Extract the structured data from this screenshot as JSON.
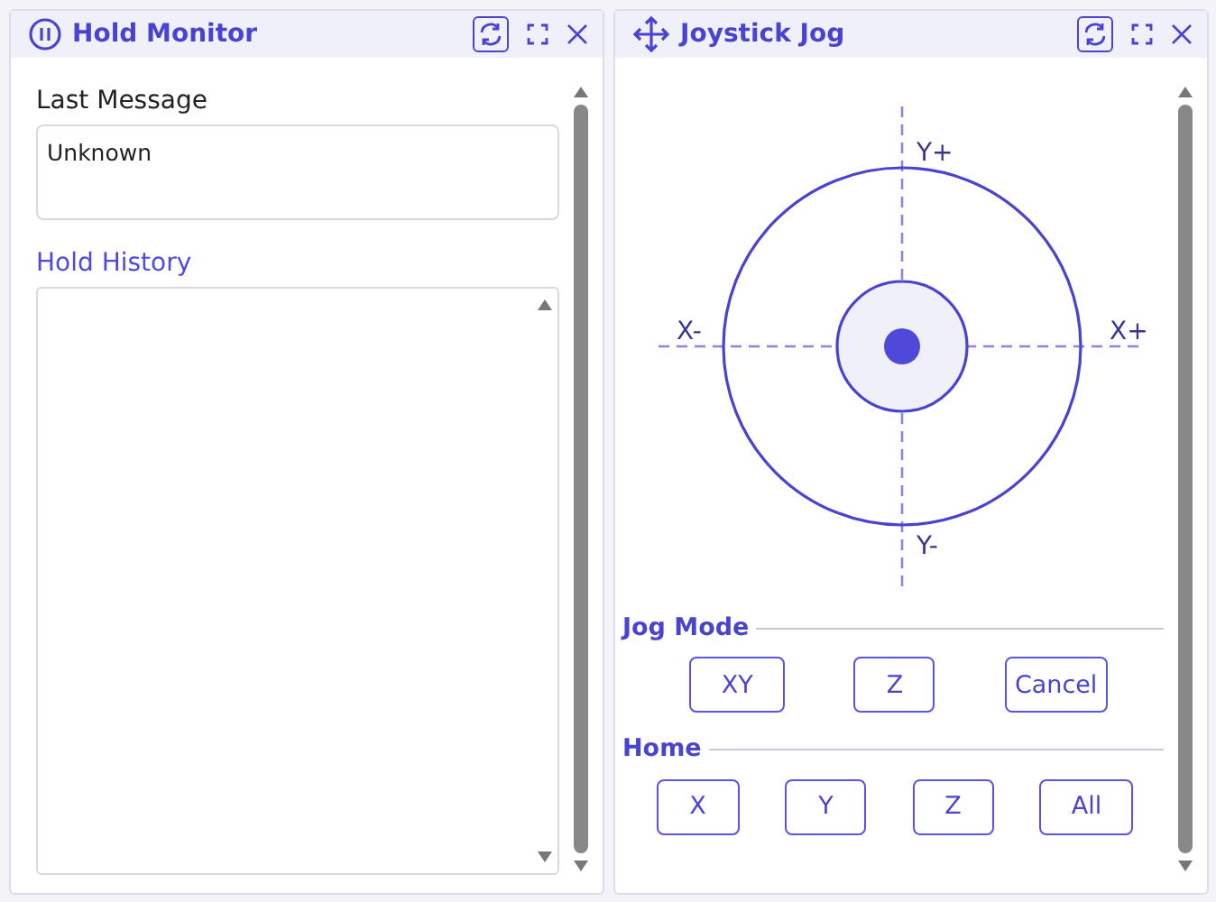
{
  "hold_monitor": {
    "title": "Hold Monitor",
    "last_message": {
      "label": "Last Message",
      "value": "Unknown"
    },
    "hold_history": {
      "label": "Hold History"
    }
  },
  "joystick_jog": {
    "title": "Joystick Jog",
    "axes": {
      "y_plus": "Y+",
      "x_minus": "X-",
      "x_plus": "X+",
      "y_minus": "Y-"
    },
    "jog_mode": {
      "label": "Jog Mode",
      "buttons": [
        "XY",
        "Z",
        "Cancel"
      ]
    },
    "home": {
      "label": "Home",
      "buttons": [
        "X",
        "Y",
        "Z",
        "All"
      ]
    }
  }
}
